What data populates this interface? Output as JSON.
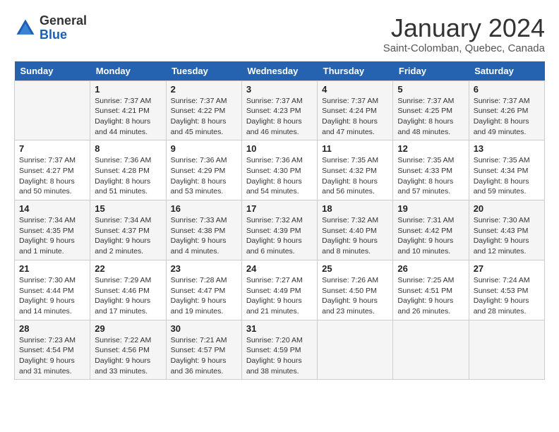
{
  "header": {
    "logo_general": "General",
    "logo_blue": "Blue",
    "month_title": "January 2024",
    "location": "Saint-Colomban, Quebec, Canada"
  },
  "calendar": {
    "days_of_week": [
      "Sunday",
      "Monday",
      "Tuesday",
      "Wednesday",
      "Thursday",
      "Friday",
      "Saturday"
    ],
    "weeks": [
      [
        {
          "day": "",
          "sunrise": "",
          "sunset": "",
          "daylight": ""
        },
        {
          "day": "1",
          "sunrise": "Sunrise: 7:37 AM",
          "sunset": "Sunset: 4:21 PM",
          "daylight": "Daylight: 8 hours and 44 minutes."
        },
        {
          "day": "2",
          "sunrise": "Sunrise: 7:37 AM",
          "sunset": "Sunset: 4:22 PM",
          "daylight": "Daylight: 8 hours and 45 minutes."
        },
        {
          "day": "3",
          "sunrise": "Sunrise: 7:37 AM",
          "sunset": "Sunset: 4:23 PM",
          "daylight": "Daylight: 8 hours and 46 minutes."
        },
        {
          "day": "4",
          "sunrise": "Sunrise: 7:37 AM",
          "sunset": "Sunset: 4:24 PM",
          "daylight": "Daylight: 8 hours and 47 minutes."
        },
        {
          "day": "5",
          "sunrise": "Sunrise: 7:37 AM",
          "sunset": "Sunset: 4:25 PM",
          "daylight": "Daylight: 8 hours and 48 minutes."
        },
        {
          "day": "6",
          "sunrise": "Sunrise: 7:37 AM",
          "sunset": "Sunset: 4:26 PM",
          "daylight": "Daylight: 8 hours and 49 minutes."
        }
      ],
      [
        {
          "day": "7",
          "sunrise": "Sunrise: 7:37 AM",
          "sunset": "Sunset: 4:27 PM",
          "daylight": "Daylight: 8 hours and 50 minutes."
        },
        {
          "day": "8",
          "sunrise": "Sunrise: 7:36 AM",
          "sunset": "Sunset: 4:28 PM",
          "daylight": "Daylight: 8 hours and 51 minutes."
        },
        {
          "day": "9",
          "sunrise": "Sunrise: 7:36 AM",
          "sunset": "Sunset: 4:29 PM",
          "daylight": "Daylight: 8 hours and 53 minutes."
        },
        {
          "day": "10",
          "sunrise": "Sunrise: 7:36 AM",
          "sunset": "Sunset: 4:30 PM",
          "daylight": "Daylight: 8 hours and 54 minutes."
        },
        {
          "day": "11",
          "sunrise": "Sunrise: 7:35 AM",
          "sunset": "Sunset: 4:32 PM",
          "daylight": "Daylight: 8 hours and 56 minutes."
        },
        {
          "day": "12",
          "sunrise": "Sunrise: 7:35 AM",
          "sunset": "Sunset: 4:33 PM",
          "daylight": "Daylight: 8 hours and 57 minutes."
        },
        {
          "day": "13",
          "sunrise": "Sunrise: 7:35 AM",
          "sunset": "Sunset: 4:34 PM",
          "daylight": "Daylight: 8 hours and 59 minutes."
        }
      ],
      [
        {
          "day": "14",
          "sunrise": "Sunrise: 7:34 AM",
          "sunset": "Sunset: 4:35 PM",
          "daylight": "Daylight: 9 hours and 1 minute."
        },
        {
          "day": "15",
          "sunrise": "Sunrise: 7:34 AM",
          "sunset": "Sunset: 4:37 PM",
          "daylight": "Daylight: 9 hours and 2 minutes."
        },
        {
          "day": "16",
          "sunrise": "Sunrise: 7:33 AM",
          "sunset": "Sunset: 4:38 PM",
          "daylight": "Daylight: 9 hours and 4 minutes."
        },
        {
          "day": "17",
          "sunrise": "Sunrise: 7:32 AM",
          "sunset": "Sunset: 4:39 PM",
          "daylight": "Daylight: 9 hours and 6 minutes."
        },
        {
          "day": "18",
          "sunrise": "Sunrise: 7:32 AM",
          "sunset": "Sunset: 4:40 PM",
          "daylight": "Daylight: 9 hours and 8 minutes."
        },
        {
          "day": "19",
          "sunrise": "Sunrise: 7:31 AM",
          "sunset": "Sunset: 4:42 PM",
          "daylight": "Daylight: 9 hours and 10 minutes."
        },
        {
          "day": "20",
          "sunrise": "Sunrise: 7:30 AM",
          "sunset": "Sunset: 4:43 PM",
          "daylight": "Daylight: 9 hours and 12 minutes."
        }
      ],
      [
        {
          "day": "21",
          "sunrise": "Sunrise: 7:30 AM",
          "sunset": "Sunset: 4:44 PM",
          "daylight": "Daylight: 9 hours and 14 minutes."
        },
        {
          "day": "22",
          "sunrise": "Sunrise: 7:29 AM",
          "sunset": "Sunset: 4:46 PM",
          "daylight": "Daylight: 9 hours and 17 minutes."
        },
        {
          "day": "23",
          "sunrise": "Sunrise: 7:28 AM",
          "sunset": "Sunset: 4:47 PM",
          "daylight": "Daylight: 9 hours and 19 minutes."
        },
        {
          "day": "24",
          "sunrise": "Sunrise: 7:27 AM",
          "sunset": "Sunset: 4:49 PM",
          "daylight": "Daylight: 9 hours and 21 minutes."
        },
        {
          "day": "25",
          "sunrise": "Sunrise: 7:26 AM",
          "sunset": "Sunset: 4:50 PM",
          "daylight": "Daylight: 9 hours and 23 minutes."
        },
        {
          "day": "26",
          "sunrise": "Sunrise: 7:25 AM",
          "sunset": "Sunset: 4:51 PM",
          "daylight": "Daylight: 9 hours and 26 minutes."
        },
        {
          "day": "27",
          "sunrise": "Sunrise: 7:24 AM",
          "sunset": "Sunset: 4:53 PM",
          "daylight": "Daylight: 9 hours and 28 minutes."
        }
      ],
      [
        {
          "day": "28",
          "sunrise": "Sunrise: 7:23 AM",
          "sunset": "Sunset: 4:54 PM",
          "daylight": "Daylight: 9 hours and 31 minutes."
        },
        {
          "day": "29",
          "sunrise": "Sunrise: 7:22 AM",
          "sunset": "Sunset: 4:56 PM",
          "daylight": "Daylight: 9 hours and 33 minutes."
        },
        {
          "day": "30",
          "sunrise": "Sunrise: 7:21 AM",
          "sunset": "Sunset: 4:57 PM",
          "daylight": "Daylight: 9 hours and 36 minutes."
        },
        {
          "day": "31",
          "sunrise": "Sunrise: 7:20 AM",
          "sunset": "Sunset: 4:59 PM",
          "daylight": "Daylight: 9 hours and 38 minutes."
        },
        {
          "day": "",
          "sunrise": "",
          "sunset": "",
          "daylight": ""
        },
        {
          "day": "",
          "sunrise": "",
          "sunset": "",
          "daylight": ""
        },
        {
          "day": "",
          "sunrise": "",
          "sunset": "",
          "daylight": ""
        }
      ]
    ]
  }
}
